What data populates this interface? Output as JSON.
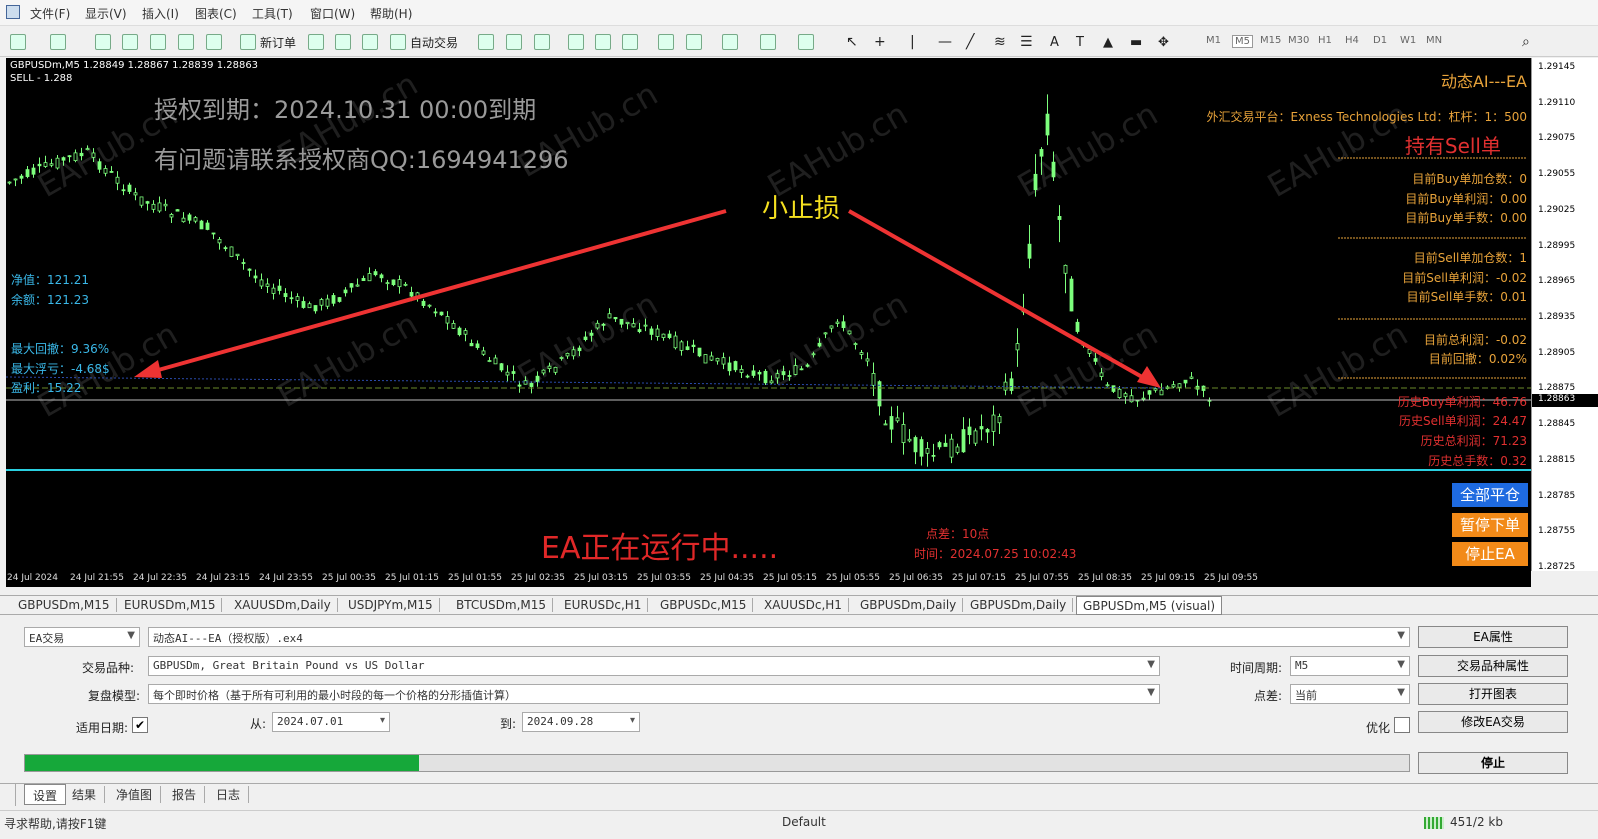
{
  "menu": {
    "items": [
      "文件(F)",
      "显示(V)",
      "插入(I)",
      "图表(C)",
      "工具(T)",
      "窗口(W)",
      "帮助(H)"
    ]
  },
  "toolbar": {
    "new_order_label": "新订单",
    "auto_trade_label": "自动交易",
    "timeframes": [
      "M1",
      "M5",
      "M15",
      "M30",
      "H1",
      "H4",
      "D1",
      "W1",
      "MN"
    ],
    "active_timeframe": "M5"
  },
  "chart": {
    "symbol_line": "GBPUSDm,M5  1.28849 1.28867 1.28839 1.28863",
    "sell_line": "SELL - 1.288",
    "license_expiry": "授权到期：2024.10.31 00:00到期",
    "contact_line": "有问题请联系授权商QQ:1694941296",
    "annotation_small_stop": "小止损",
    "ea_running": "EA正在运行中.....",
    "points_label": "点差：10点",
    "time_label": "时间：2024.07.25 10:02:43",
    "left_info": {
      "equity": "净值：121.21",
      "balance": "余额：121.23",
      "max_drawdown": "最大回撤：9.36%",
      "max_float_loss": "最大浮亏：-4.68$",
      "third_line": "盈利：15.22"
    },
    "panel": {
      "title": "动态AI---EA",
      "platform": "外汇交易平台：Exness Technologies Ltd：杠杆：1：500",
      "holding": "持有Sell单",
      "buy_add": "目前Buy单加仓数：0",
      "buy_profit": "目前Buy单利润：0.00",
      "buy_lots": "目前Buy单手数：0.00",
      "sell_add": "目前Sell单加仓数：1",
      "sell_profit": "目前Sell单利润：-0.02",
      "sell_lots": "目前Sell单手数：0.01",
      "total_profit": "目前总利润：-0.02",
      "drawdown": "目前回撤：0.02%",
      "hist_buy": "历史Buy单利润：46.76",
      "hist_sell": "历史Sell单利润：24.47",
      "hist_total": "历史总利润：71.23",
      "hist_lots": "历史总手数：0.32"
    },
    "buttons": {
      "close_all": "全部平仓",
      "pause": "暂停下单",
      "stop_ea": "停止EA"
    },
    "watermark": "EAHub.cn",
    "current_price_label": "1.28863"
  },
  "price_scale": [
    "1.29145",
    "1.29110",
    "1.29075",
    "1.29055",
    "1.29025",
    "1.28995",
    "1.28965",
    "1.28935",
    "1.28905",
    "1.28875",
    "1.28845",
    "1.28815",
    "1.28785",
    "1.28755",
    "1.28725"
  ],
  "time_axis": [
    "24 Jul 2024",
    "24 Jul 21:55",
    "24 Jul 22:35",
    "24 Jul 23:15",
    "24 Jul 23:55",
    "25 Jul 00:35",
    "25 Jul 01:15",
    "25 Jul 01:55",
    "25 Jul 02:35",
    "25 Jul 03:15",
    "25 Jul 03:55",
    "25 Jul 04:35",
    "25 Jul 05:15",
    "25 Jul 05:55",
    "25 Jul 06:35",
    "25 Jul 07:15",
    "25 Jul 07:55",
    "25 Jul 08:35",
    "25 Jul 09:15",
    "25 Jul 09:55"
  ],
  "chart_tabs": [
    "GBPUSDm,M15",
    "EURUSDm,M15",
    "XAUUSDm,Daily",
    "USDJPYm,M15",
    "BTCUSDm,M15",
    "EURUSDc,H1",
    "GBPUSDc,M15",
    "XAUUSDc,H1",
    "GBPUSDm,Daily",
    "GBPUSDm,Daily",
    "GBPUSDm,M5 (visual)"
  ],
  "tester": {
    "type_value": "EA交易",
    "ea_value": "动态AI---EA（授权版）.ex4",
    "symbol_label": "交易品种:",
    "symbol_value": "GBPUSDm, Great Britain Pound vs US Dollar",
    "model_label": "复盘模型:",
    "model_value": "每个即时价格（基于所有可利用的最小时段的每一个价格的分形插值计算）",
    "use_date_label": "适用日期:",
    "from_label": "从:",
    "from_value": "2024.07.01",
    "to_label": "到:",
    "to_value": "2024.09.28",
    "period_label": "时间周期:",
    "period_value": "M5",
    "spread_label": "点差:",
    "spread_value": "当前",
    "optimize_label": "优化",
    "btn_ea_props": "EA属性",
    "btn_symbol_props": "交易品种属性",
    "btn_open_chart": "打开图表",
    "btn_modify_ea": "修改EA交易",
    "btn_stop": "停止",
    "progress": 0.285
  },
  "bottom_tabs": [
    "设置",
    "结果",
    "净值图",
    "报告",
    "日志"
  ],
  "status": {
    "help": "寻求帮助,请按F1键",
    "profile": "Default",
    "traffic": "451/2 kb"
  }
}
